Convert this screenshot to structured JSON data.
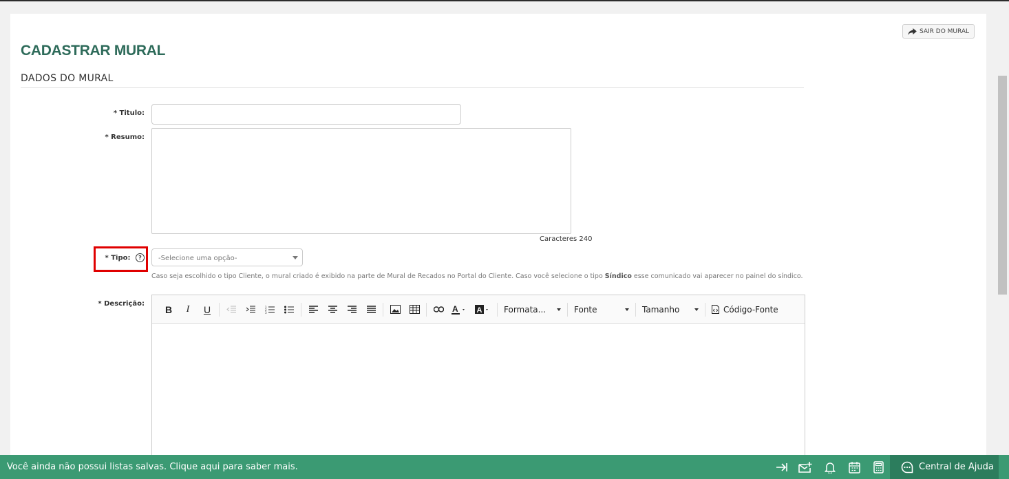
{
  "header": {
    "exit_label": "SAIR DO MURAL",
    "page_title": "CADASTRAR MURAL",
    "section_title": "DADOS DO MURAL"
  },
  "form": {
    "titulo_label": "Titulo:",
    "titulo_value": "",
    "resumo_label": "Resumo:",
    "resumo_value": "",
    "counter_text": "Caracteres 240",
    "tipo_label": "Tipo:",
    "tipo_placeholder": "-Selecione uma opção-",
    "tipo_hint_pre": "Caso seja escolhido o tipo Cliente, o mural criado é exibido na parte de Mural de Recados no Portal do Cliente. Caso você selecione o tipo ",
    "tipo_hint_bold": "Síndico",
    "tipo_hint_post": " esse comunicado vai aparecer no painel do síndico.",
    "descricao_label": "Descrição:",
    "required_mark": "*"
  },
  "editor": {
    "bold": "B",
    "italic": "I",
    "underline": "U",
    "format_label": "Formata...",
    "font_label": "Fonte",
    "size_label": "Tamanho",
    "source_label": "Código-Fonte"
  },
  "bottom_bar": {
    "message": "Você ainda não possui listas salvas. Clique aqui para saber mais.",
    "help_center_label": "Central de Ajuda",
    "background_color": "#3b9a73"
  },
  "colors": {
    "title": "#2e6b5a",
    "highlight": "#e00000"
  }
}
